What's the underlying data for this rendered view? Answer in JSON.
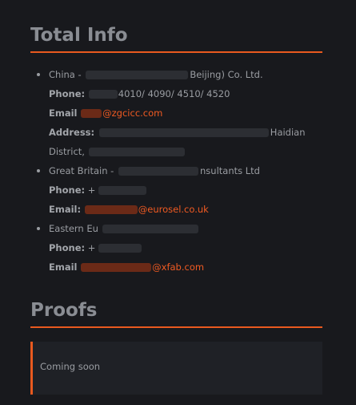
{
  "sections": {
    "total_info": {
      "title": "Total Info"
    },
    "proofs": {
      "title": "Proofs",
      "callout": "Coming soon"
    }
  },
  "contacts": [
    {
      "name_prefix": "China -",
      "name_suffix": "Beijing) Co. Ltd.",
      "phone_label": "Phone",
      "phone_value": "4010/ 4090/ 4510/ 4520",
      "email_label": "Email",
      "email_domain": "@zgcicc.com",
      "address_label": "Address",
      "address_end": "Haidian",
      "address_line2": "District,"
    },
    {
      "name_prefix": "Great Britain -",
      "name_suffix": "nsultants Ltd",
      "phone_label": "Phone",
      "phone_value": "+",
      "email_label": "Email:",
      "email_domain": "@eurosel.co.uk"
    },
    {
      "name_prefix": "Eastern Eu",
      "phone_label": "Phone",
      "phone_value": "+",
      "email_label": "Email",
      "email_domain": "@xfab.com"
    }
  ]
}
